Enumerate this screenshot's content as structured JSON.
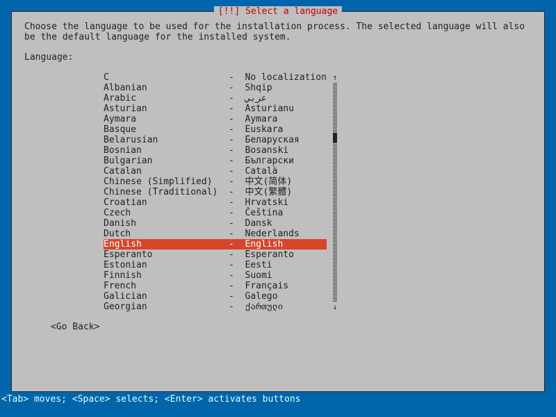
{
  "dialog": {
    "title_prefix": "[!!] ",
    "title_text": "Select a language",
    "instruction": "Choose the language to be used for the installation process. The selected language will also be the default language for the installed system.",
    "prompt": "Language:",
    "go_back": "<Go Back>"
  },
  "languages": [
    {
      "name": "C",
      "native": "No localization"
    },
    {
      "name": "Albanian",
      "native": "Shqip"
    },
    {
      "name": "Arabic",
      "native": "عربي"
    },
    {
      "name": "Asturian",
      "native": "Asturianu"
    },
    {
      "name": "Aymara",
      "native": "Aymara"
    },
    {
      "name": "Basque",
      "native": "Euskara"
    },
    {
      "name": "Belarusian",
      "native": "Беларуская"
    },
    {
      "name": "Bosnian",
      "native": "Bosanski"
    },
    {
      "name": "Bulgarian",
      "native": "Български"
    },
    {
      "name": "Catalan",
      "native": "Català"
    },
    {
      "name": "Chinese (Simplified)",
      "native": "中文(简体)"
    },
    {
      "name": "Chinese (Traditional)",
      "native": "中文(繁體)"
    },
    {
      "name": "Croatian",
      "native": "Hrvatski"
    },
    {
      "name": "Czech",
      "native": "Čeština"
    },
    {
      "name": "Danish",
      "native": "Dansk"
    },
    {
      "name": "Dutch",
      "native": "Nederlands"
    },
    {
      "name": "English",
      "native": "English"
    },
    {
      "name": "Esperanto",
      "native": "Esperanto"
    },
    {
      "name": "Estonian",
      "native": "Eesti"
    },
    {
      "name": "Finnish",
      "native": "Suomi"
    },
    {
      "name": "French",
      "native": "Français"
    },
    {
      "name": "Galician",
      "native": "Galego"
    },
    {
      "name": "Georgian",
      "native": "ქართული"
    }
  ],
  "selected_index": 16,
  "columns": {
    "name_width": 22,
    "separator": "-"
  },
  "scrollbar": {
    "up_arrow": "↑",
    "down_arrow": "↓"
  },
  "footer": "<Tab> moves; <Space> selects; <Enter> activates buttons"
}
